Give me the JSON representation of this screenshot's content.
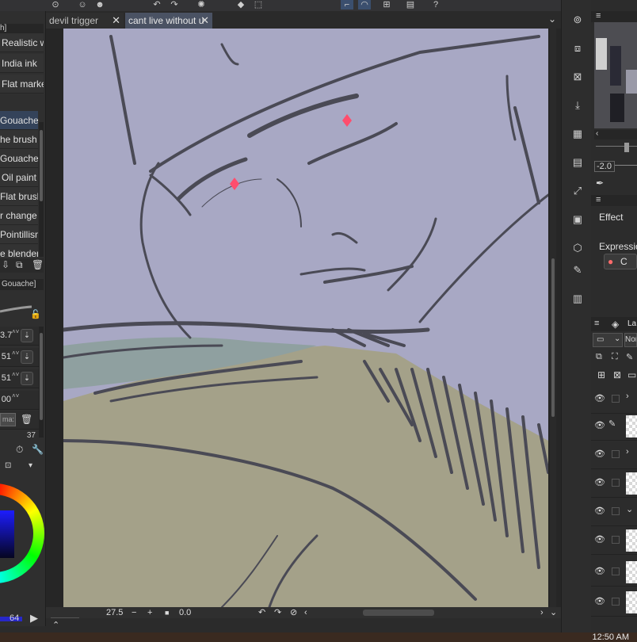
{
  "tabs": [
    {
      "label": "devil trigger",
      "close": "✕"
    },
    {
      "label": "cant live without u",
      "close": "✕"
    }
  ],
  "subtools": {
    "header": "h]",
    "top_items": [
      "Realistic w",
      "India ink",
      "Flat marker"
    ],
    "brush_items": [
      "Gouache",
      "he brush",
      "Gouache",
      "Oil paint",
      "Flat brush",
      "r change",
      "Pointillism",
      "e blender"
    ],
    "selected_index": 0
  },
  "tool_property": {
    "title": "Gouache]",
    "values": [
      "3.7",
      "51",
      "51",
      "00"
    ],
    "mask_label": "ma:",
    "last_value": "37"
  },
  "color_wheel": {
    "value_label": "64",
    "hue_color": "#2a2aff"
  },
  "status_bar": {
    "zoom": "27.5",
    "rotation": "0.0",
    "minus": "−",
    "plus": "+"
  },
  "navigator": {
    "rotate_value": "-2.0"
  },
  "panels": {
    "effect_label": "Effect",
    "expression_label": "Expression",
    "expression_value": "C",
    "layer_tab_label": "La",
    "blend_mode": "Nor"
  },
  "layers": [
    {
      "visible": true,
      "type": "folder"
    },
    {
      "visible": true,
      "type": "raster",
      "editing": true
    },
    {
      "visible": true,
      "type": "folder"
    },
    {
      "visible": true,
      "type": "raster"
    },
    {
      "visible": true,
      "type": "folder-open"
    },
    {
      "visible": true,
      "type": "raster"
    },
    {
      "visible": true,
      "type": "raster"
    },
    {
      "visible": true,
      "type": "raster"
    }
  ],
  "clock": "12:50 AM",
  "colors": {
    "canvas_bg": "#a8a8c4",
    "accent_tab": "#4a5263",
    "selected_row": "#34435a",
    "eye_color": "#ff4d6d"
  }
}
